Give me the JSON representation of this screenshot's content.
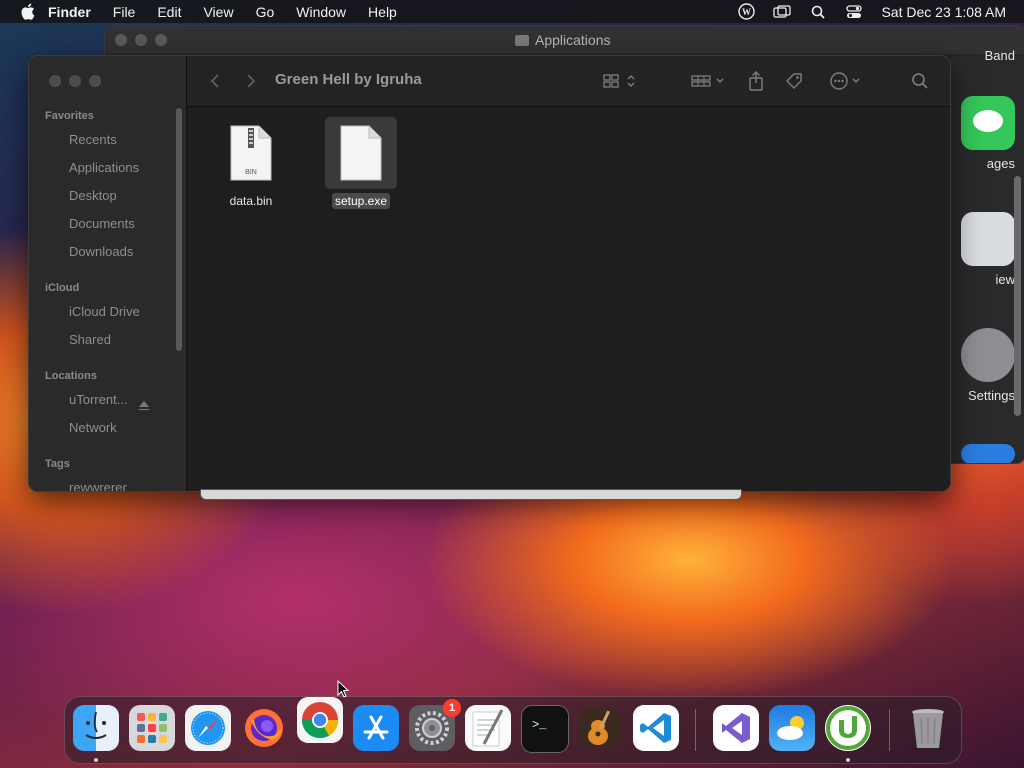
{
  "menubar": {
    "app": "Finder",
    "items": [
      "File",
      "Edit",
      "View",
      "Go",
      "Window",
      "Help"
    ],
    "clock": "Sat Dec 23  1:08 AM",
    "status_icons": [
      "wordpress-icon",
      "screen-mirroring-icon",
      "search-icon",
      "control-center-icon"
    ]
  },
  "background_window": {
    "title": "Applications",
    "partial_top_label": "Band",
    "apps": [
      {
        "label": "ages",
        "color": "#34c759"
      },
      {
        "label": "iew",
        "color": "#d9dce0"
      },
      {
        "label": "Settings",
        "color": "#8e8e93"
      }
    ]
  },
  "finder": {
    "title": "Green Hell by Igruha",
    "sidebar": {
      "favorites_header": "Favorites",
      "favorites": [
        "Recents",
        "Applications",
        "Desktop",
        "Documents",
        "Downloads"
      ],
      "icloud_header": "iCloud",
      "icloud": [
        "iCloud Drive",
        "Shared"
      ],
      "locations_header": "Locations",
      "locations": [
        "uTorrent...",
        "Network"
      ],
      "tags_header": "Tags",
      "tags": [
        "rewwrerer"
      ]
    },
    "files": [
      {
        "name": "data.bin",
        "type_label": "BIN",
        "selected": false
      },
      {
        "name": "setup.exe",
        "selected": true
      }
    ]
  },
  "dock": {
    "apps": [
      {
        "name": "Finder",
        "icon": "finder-icon",
        "running": true
      },
      {
        "name": "Launchpad",
        "icon": "launchpad-icon",
        "running": false
      },
      {
        "name": "Safari",
        "icon": "safari-icon",
        "running": false
      },
      {
        "name": "Firefox",
        "icon": "firefox-icon",
        "running": false
      },
      {
        "name": "Google Chrome",
        "icon": "chrome-icon",
        "running": false
      },
      {
        "name": "App Store",
        "icon": "app-store-icon",
        "running": false
      },
      {
        "name": "System Settings",
        "icon": "system-settings-icon",
        "running": false,
        "badge": "1"
      },
      {
        "name": "TextEdit",
        "icon": "textedit-icon",
        "running": false
      },
      {
        "name": "Terminal",
        "icon": "terminal-icon",
        "running": false
      },
      {
        "name": "GarageBand",
        "icon": "garageband-icon",
        "running": false
      },
      {
        "name": "Visual Studio Code",
        "icon": "vscode-icon",
        "running": false
      },
      {
        "name": "Visual Studio",
        "icon": "visual-studio-icon",
        "running": false
      },
      {
        "name": "Weather",
        "icon": "weather-icon",
        "running": false
      },
      {
        "name": "uTorrent",
        "icon": "utorrent-icon",
        "running": true
      },
      {
        "name": "Trash",
        "icon": "trash-icon",
        "running": false
      }
    ]
  }
}
